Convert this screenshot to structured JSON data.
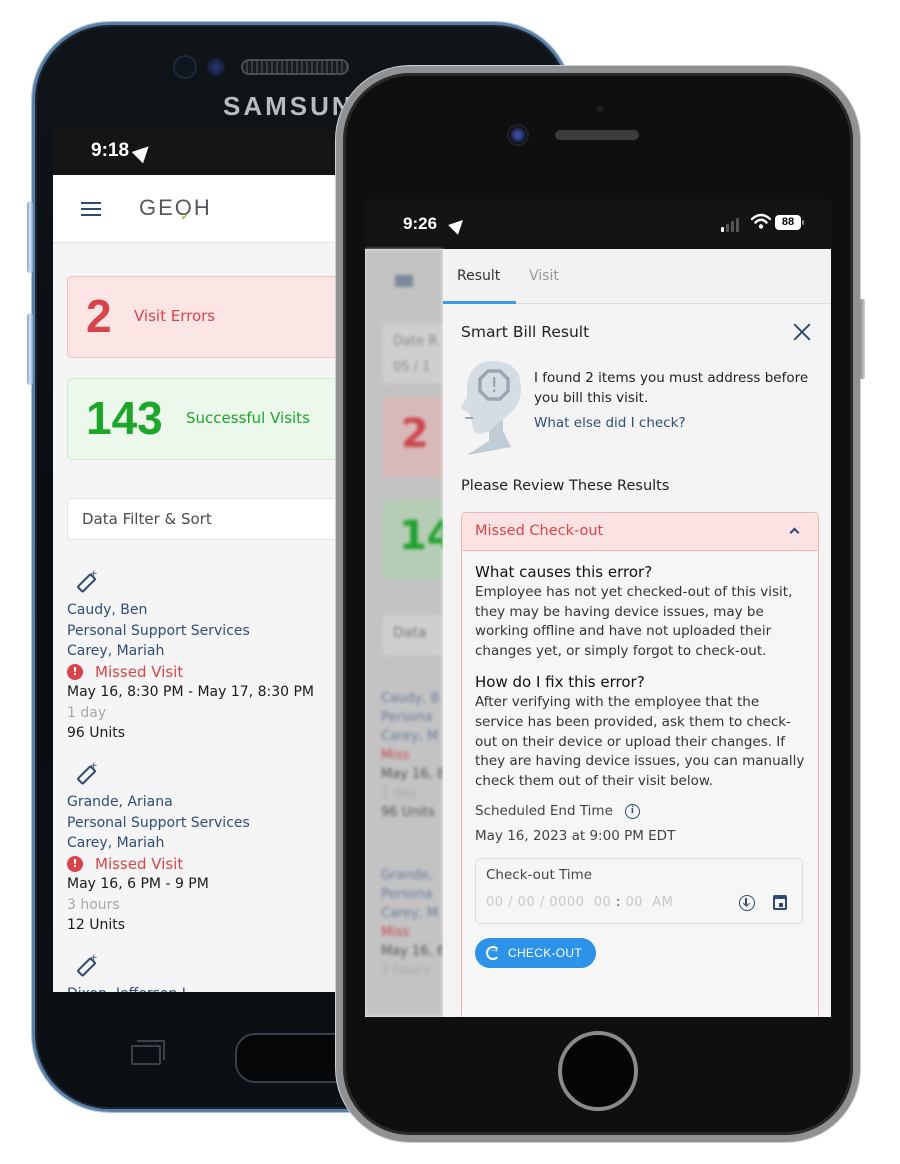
{
  "back_phone": {
    "brand": "SAMSUNG",
    "status": {
      "time": "9:18",
      "location_icon": "location-arrow-icon"
    },
    "app": {
      "menu_icon": "hamburger-menu-icon",
      "logo": {
        "text_before": "GE",
        "text_after": "H",
        "mark": "O"
      }
    },
    "stats": [
      {
        "value": "2",
        "label": "Visit Errors",
        "color": "#d9444a"
      },
      {
        "value": "143",
        "label": "Successful Visits",
        "color": "#1ea62b"
      }
    ],
    "filter_label": "Data Filter & Sort",
    "visits": [
      {
        "client": "Caudy, Ben",
        "service": "Personal Support Services",
        "employee": "Carey, Mariah",
        "status": "Missed Visit",
        "time_range": "May 16, 8:30 PM - May 17, 8:30 PM",
        "duration": "1 day",
        "units": "96 Units"
      },
      {
        "client": "Grande, Ariana",
        "service": "Personal Support Services",
        "employee": "Carey, Mariah",
        "status": "Missed Visit",
        "time_range": "May 16, 6 PM - 9 PM",
        "duration": "3 hours",
        "units": "12 Units"
      },
      {
        "client": "Dixon, Jefferson L"
      }
    ]
  },
  "front_phone": {
    "status": {
      "time": "9:26",
      "battery": "88"
    },
    "backdrop": {
      "date_label": "Date R",
      "date_value": "05 / 1",
      "error_count": "2",
      "success_count": "14",
      "filter": "Data",
      "list": [
        {
          "client": "Caudy, B",
          "service": "Persona",
          "employee": "Carey, M",
          "status": "Miss",
          "time": "May 16, 8",
          "duration": "1 day",
          "units": "96 Units"
        },
        {
          "client": "Grande,",
          "service": "Persona",
          "employee": "Carey, M",
          "status": "Miss",
          "time": "May 16, 6",
          "duration": "3 hours"
        }
      ]
    },
    "tabs": [
      {
        "label": "Result",
        "active": true
      },
      {
        "label": "Visit",
        "active": false
      }
    ],
    "panel": {
      "title": "Smart Bill Result",
      "found_text": "I found 2 items you must address before you bill this visit.",
      "found_link": "What else did I check?",
      "review_heading": "Please Review These Results",
      "accordion": {
        "title": "Missed Check-out",
        "expanded": true,
        "q1": "What causes this error?",
        "a1": "Employee has not yet checked-out of this visit, they may be having device issues, may be working offline and have not uploaded their changes yet, or simply forgot to check-out.",
        "q2": "How do I fix this error?",
        "a2": "After verifying with the employee that the service has been provided, ask them to check-out on their device or upload their changes. If they are having device issues, you can manually check them out of their visit below.",
        "scheduled_label": "Scheduled End Time",
        "scheduled_value": "May 16, 2023 at 9:00 PM EDT",
        "checkout_field": {
          "label": "Check-out Time",
          "placeholder_date": "00 / 00 / 0000",
          "placeholder_hour": "00",
          "placeholder_min": "00",
          "placeholder_ampm": "AM"
        },
        "checkout_button": "CHECK-OUT"
      }
    }
  }
}
